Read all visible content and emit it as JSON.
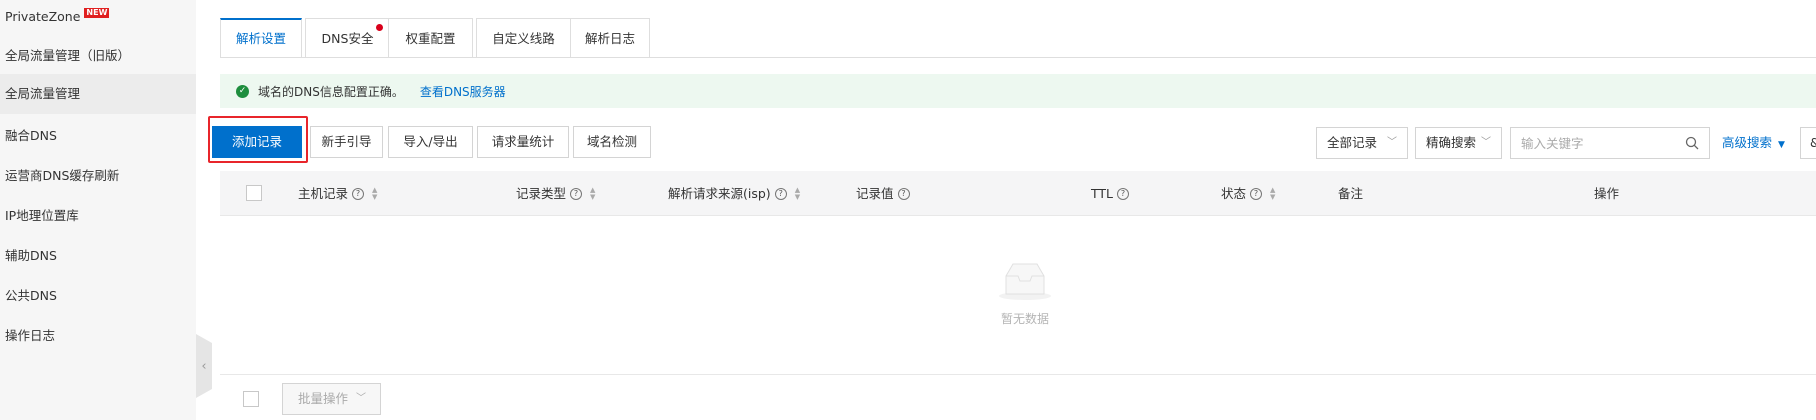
{
  "sidebar": {
    "items": [
      {
        "label": "PrivateZone",
        "badge": "NEW"
      },
      {
        "label": "全局流量管理（旧版）"
      },
      {
        "label": "全局流量管理",
        "active": true
      },
      {
        "label": "融合DNS"
      },
      {
        "label": "运营商DNS缓存刷新"
      },
      {
        "label": "IP地理位置库"
      },
      {
        "label": "辅助DNS"
      },
      {
        "label": "公共DNS"
      },
      {
        "label": "操作日志"
      }
    ],
    "collapse_icon": "‹"
  },
  "tabs": [
    {
      "label": "解析设置",
      "active": true
    },
    {
      "label": "DNS安全",
      "has_dot": true
    },
    {
      "label": "权重配置"
    },
    {
      "label": "自定义线路"
    },
    {
      "label": "解析日志"
    }
  ],
  "alert": {
    "text": "域名的DNS信息配置正确。",
    "link": "查看DNS服务器",
    "icon": "check-circle-icon"
  },
  "toolbar": {
    "add_record": "添加记录",
    "guide": "新手引导",
    "import_export": "导入/导出",
    "request_stats": "请求量统计",
    "domain_check": "域名检测",
    "filter_select": "全部记录",
    "search_mode": "精确搜索",
    "search_placeholder": "输入关键字",
    "advanced_search": "高级搜索",
    "edge_btn": "&"
  },
  "table": {
    "columns": [
      {
        "label": "主机记录",
        "help": true,
        "sortable": true
      },
      {
        "label": "记录类型",
        "help": true,
        "sortable": true
      },
      {
        "label": "解析请求来源(isp)",
        "help": true,
        "sortable": true
      },
      {
        "label": "记录值",
        "help": true,
        "sortable": false
      },
      {
        "label": "TTL",
        "help": true,
        "sortable": false
      },
      {
        "label": "状态",
        "help": true,
        "sortable": true
      },
      {
        "label": "备注",
        "help": false,
        "sortable": false
      },
      {
        "label": "操作",
        "help": false,
        "sortable": false
      }
    ],
    "rows": [],
    "empty_text": "暂无数据"
  },
  "footer": {
    "batch_ops": "批量操作"
  },
  "colors": {
    "primary": "#0070cc",
    "success": "#1e8e3e",
    "highlight": "#e8252b",
    "badge": "#e02020"
  }
}
